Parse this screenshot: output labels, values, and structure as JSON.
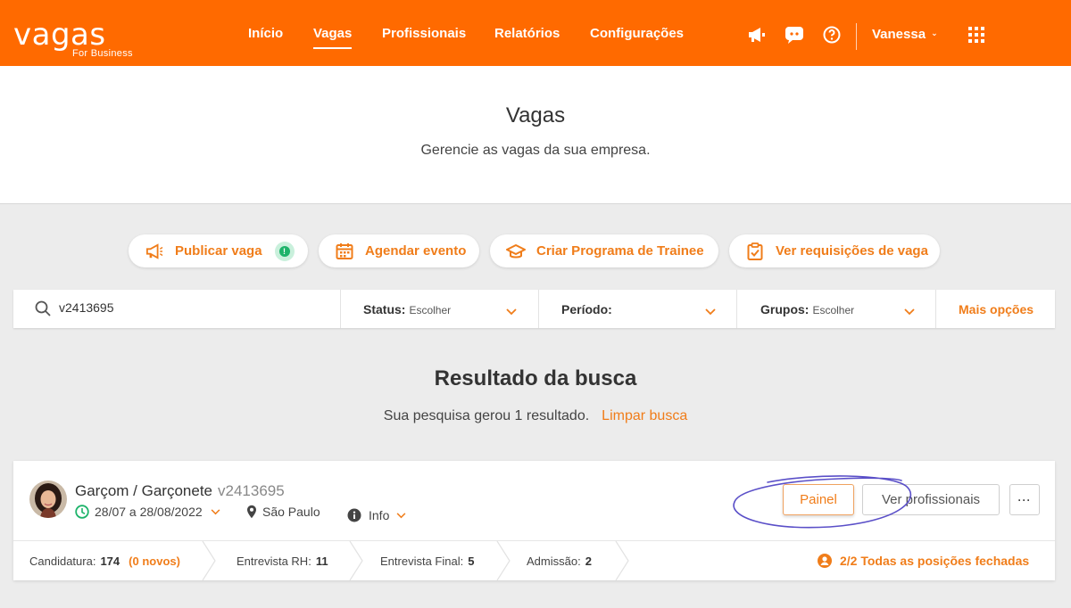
{
  "brand": {
    "name": "vagas",
    "tagline": "For Business",
    "accent": "#ff6a00",
    "link_color": "#f07d1a"
  },
  "nav": {
    "items": [
      {
        "label": "Início",
        "active": false
      },
      {
        "label": "Vagas",
        "active": true
      },
      {
        "label": "Profissionais",
        "active": false
      },
      {
        "label": "Relatórios",
        "active": false
      },
      {
        "label": "Configurações",
        "active": false
      }
    ],
    "icons": [
      "megaphone-icon",
      "chat-icon",
      "help-icon",
      "apps-grid-icon"
    ],
    "user": "Vanessa"
  },
  "hero": {
    "title": "Vagas",
    "subtitle": "Gerencie as vagas da sua empresa."
  },
  "actions": [
    {
      "label": "Publicar vaga",
      "icon": "megaphone-icon",
      "badge": "!"
    },
    {
      "label": "Agendar evento",
      "icon": "calendar-icon"
    },
    {
      "label": "Criar Programa de Trainee",
      "icon": "graduation-cap-icon"
    },
    {
      "label": "Ver requisições de vaga",
      "icon": "clipboard-check-icon"
    }
  ],
  "search": {
    "value": "v2413695",
    "filters": [
      {
        "label": "Status:",
        "value": "Escolher"
      },
      {
        "label": "Período:",
        "value": ""
      },
      {
        "label": "Grupos:",
        "value": "Escolher"
      }
    ],
    "more": "Mais opções"
  },
  "results": {
    "title": "Resultado da busca",
    "summary": "Sua pesquisa gerou 1 resultado.",
    "clear": "Limpar busca"
  },
  "job": {
    "title": "Garçom / Garçonete",
    "code": "v2413695",
    "period": "28/07 a 28/08/2022",
    "location": "São Paulo",
    "info": "Info",
    "buttons": {
      "panel": "Painel",
      "professionals": "Ver profissionais",
      "more": "···"
    },
    "pipeline": [
      {
        "label": "Candidatura:",
        "count": "174",
        "extra": "(0 novos)"
      },
      {
        "label": "Entrevista RH:",
        "count": "11"
      },
      {
        "label": "Entrevista Final:",
        "count": "5"
      },
      {
        "label": "Admissão:",
        "count": "2"
      }
    ],
    "positions_status": "2/2 Todas as posições fechadas"
  }
}
